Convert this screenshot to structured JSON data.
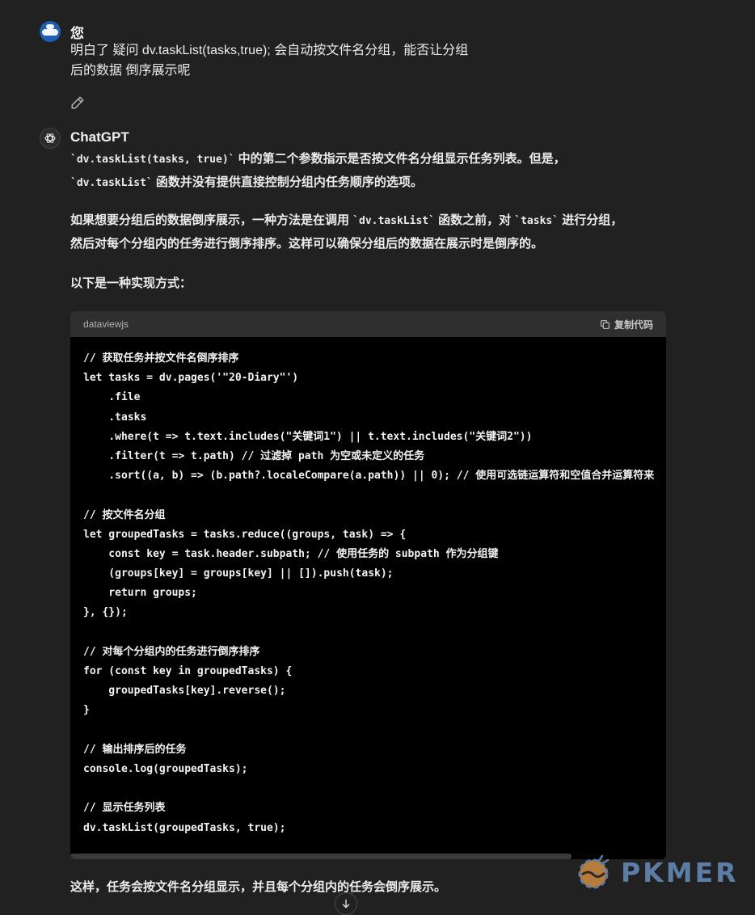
{
  "user": {
    "name": "您",
    "message_line1": "明白了 疑问 dv.taskList(tasks,true); 会自动按文件名分组，能否让分组",
    "message_line2": "后的数据 倒序展示呢"
  },
  "assistant": {
    "name": "ChatGPT",
    "p1_code": "`dv.taskList(tasks, true)`",
    "p1_text": " 中的第二个参数指示是否按文件名分组显示任务列表。但是，",
    "p1b_code": "`dv.taskList`",
    "p1b_text": " 函数并没有提供直接控制分组内任务顺序的选项。",
    "p2_a": "如果想要分组后的数据倒序展示，一种方法是在调用 ",
    "p2_code1": "`dv.taskList`",
    "p2_b": " 函数之前，对 ",
    "p2_code2": "`tasks`",
    "p2_c": " 进行分组，",
    "p2_line2": "然后对每个分组内的任务进行倒序排序。这样可以确保分组后的数据在展示时是倒序的。",
    "p3": "以下是一种实现方式：",
    "footer": "这样，任务会按文件名分组显示，并且每个分组内的任务会倒序展示。"
  },
  "code_block": {
    "language": "dataviewjs",
    "copy_label": "复制代码",
    "lines": [
      "// 获取任务并按文件名倒序排序",
      "let tasks = dv.pages('\"20-Diary\"')",
      "    .file",
      "    .tasks",
      "    .where(t => t.text.includes(\"关键词1\") || t.text.includes(\"关键词2\"))",
      "    .filter(t => t.path) // 过滤掉 path 为空或未定义的任务",
      "    .sort((a, b) => (b.path?.localeCompare(a.path)) || 0); // 使用可选链运算符和空值合并运算符来",
      "",
      "// 按文件名分组",
      "let groupedTasks = tasks.reduce((groups, task) => {",
      "    const key = task.header.subpath; // 使用任务的 subpath 作为分组键",
      "    (groups[key] = groups[key] || []).push(task);",
      "    return groups;",
      "}, {});",
      "",
      "// 对每个分组内的任务进行倒序排序",
      "for (const key in groupedTasks) {",
      "    groupedTasks[key].reverse();",
      "}",
      "",
      "// 输出排序后的任务",
      "console.log(groupedTasks);",
      "",
      "// 显示任务列表",
      "dv.taskList(groupedTasks, true);"
    ]
  },
  "watermark": "PKMER",
  "icons": {
    "edit": "pencil-icon",
    "copy": "copy-icon",
    "scroll": "arrow-down-icon",
    "gpt": "openai-logo-icon"
  }
}
